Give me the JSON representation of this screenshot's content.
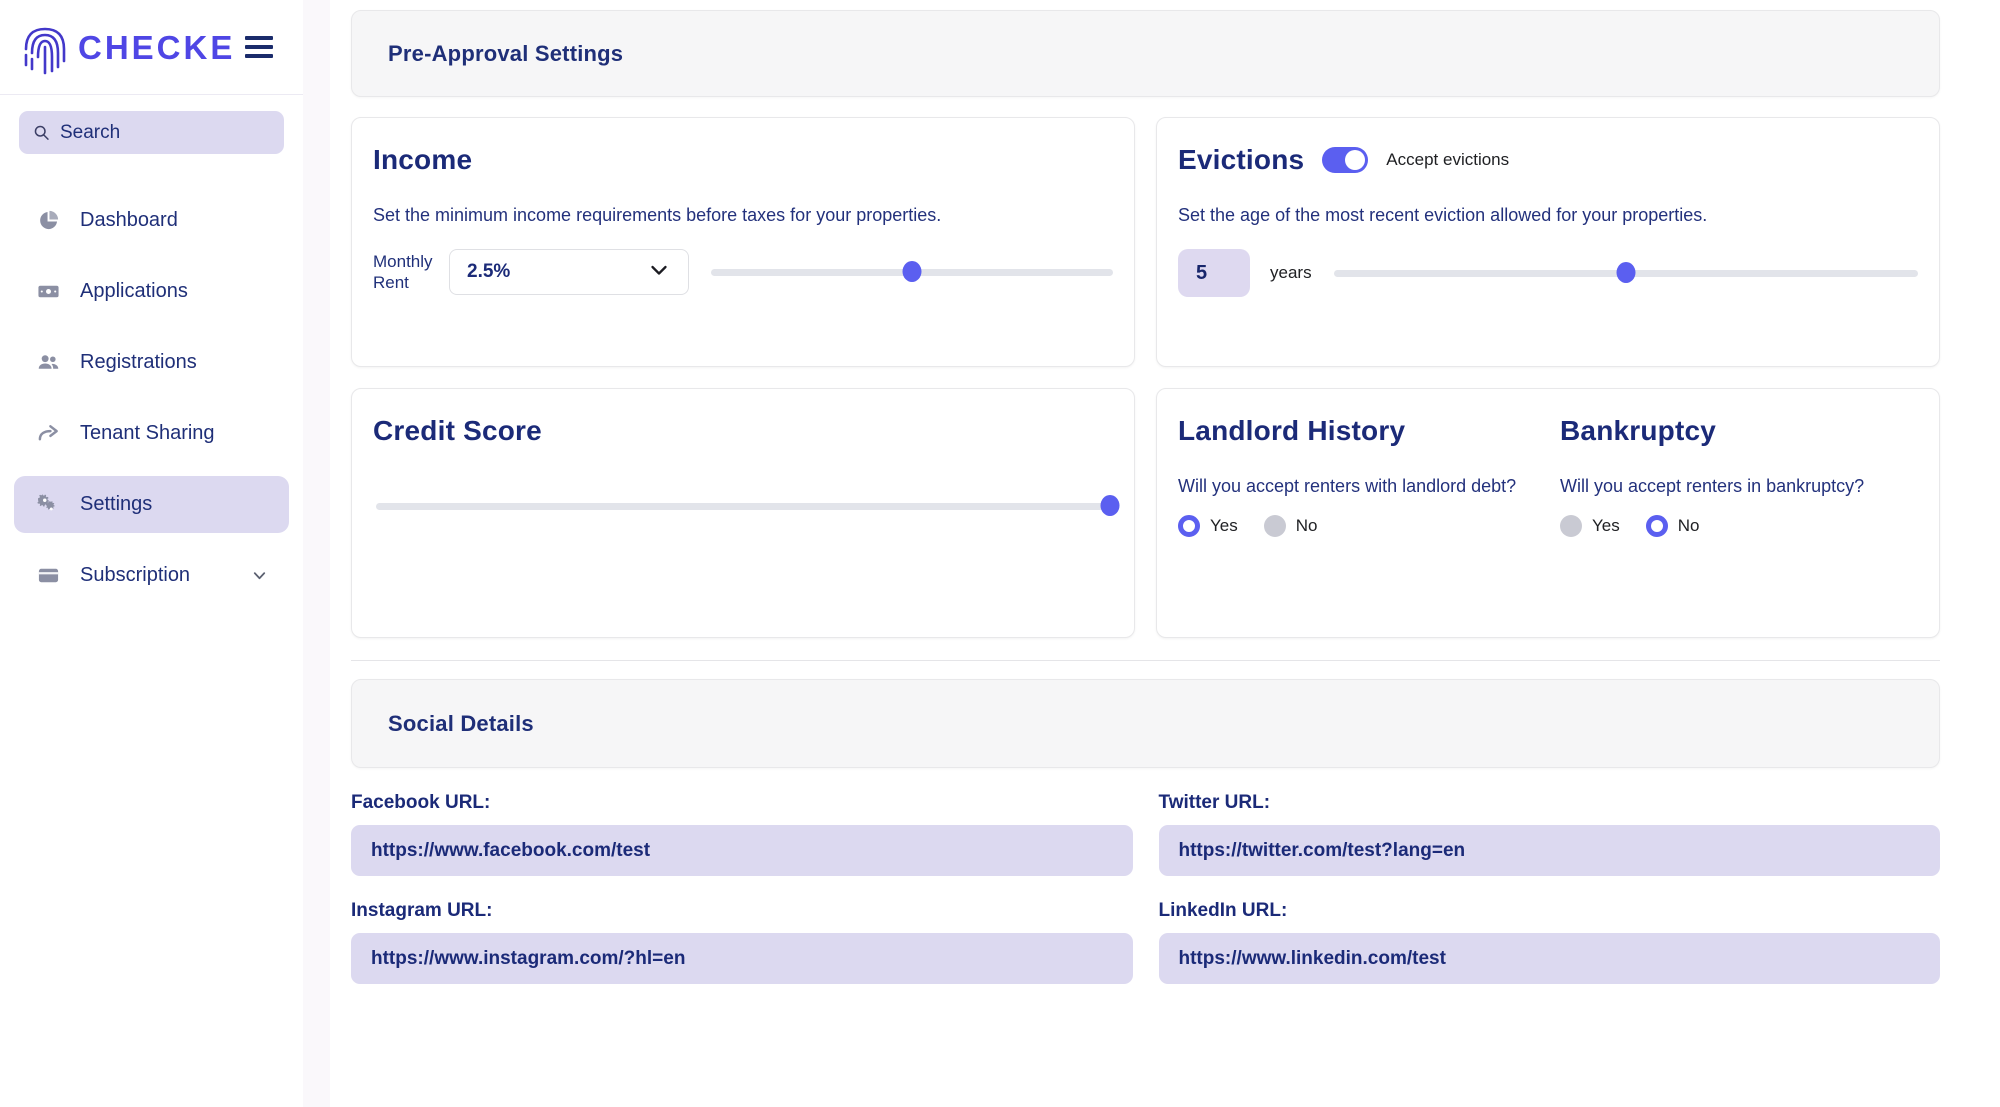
{
  "brand": {
    "name": "CHECKE",
    "logo_icon": "fingerprint-icon",
    "menu_icon": "hamburger-menu-icon"
  },
  "search": {
    "placeholder": "Search",
    "icon": "search-icon"
  },
  "sidebar": {
    "items": [
      {
        "label": "Dashboard",
        "icon": "pie-chart-icon",
        "active": false
      },
      {
        "label": "Applications",
        "icon": "banknote-icon",
        "active": false
      },
      {
        "label": "Registrations",
        "icon": "people-icon",
        "active": false
      },
      {
        "label": "Tenant Sharing",
        "icon": "share-arrow-icon",
        "active": false
      },
      {
        "label": "Settings",
        "icon": "gears-icon",
        "active": true
      },
      {
        "label": "Subscription",
        "icon": "wallet-icon",
        "active": false,
        "chevron": "chevron-down-icon"
      }
    ]
  },
  "preapproval": {
    "header_title": "Pre-Approval Settings",
    "income": {
      "title": "Income",
      "description": "Set the minimum income requirements before taxes for your properties.",
      "rent_label": "Monthly Rent",
      "select_value": "2.5%",
      "select_options": [
        "2.5%"
      ],
      "slider_percent": 50
    },
    "evictions": {
      "title": "Evictions",
      "toggle_on": true,
      "toggle_label": "Accept evictions",
      "description": "Set the age of the most recent eviction allowed for your properties.",
      "value": "5",
      "unit": "years",
      "slider_percent": 50
    },
    "credit_score": {
      "title": "Credit Score",
      "slider_percent": 100
    },
    "landlord_history": {
      "title": "Landlord History",
      "question": "Will you accept renters with landlord debt?",
      "options": [
        {
          "label": "Yes",
          "selected": true
        },
        {
          "label": "No",
          "selected": false
        }
      ]
    },
    "bankruptcy": {
      "title": "Bankruptcy",
      "question": "Will you accept renters in bankruptcy?",
      "options": [
        {
          "label": "Yes",
          "selected": false
        },
        {
          "label": "No",
          "selected": true
        }
      ]
    }
  },
  "social": {
    "header_title": "Social Details",
    "fields": [
      {
        "label": "Facebook URL:",
        "value": "https://www.facebook.com/test"
      },
      {
        "label": "Twitter URL:",
        "value": "https://twitter.com/test?lang=en"
      },
      {
        "label": "Instagram URL:",
        "value": "https://www.instagram.com/?hl=en"
      },
      {
        "label": "LinkedIn URL:",
        "value": "https://www.linkedin.com/test"
      }
    ]
  },
  "colors": {
    "accent": "#5b5ff0",
    "brand": "#4f46e5",
    "navy": "#1b2a78",
    "lavender": "#dcd9f0",
    "track": "#e2e4ea"
  }
}
